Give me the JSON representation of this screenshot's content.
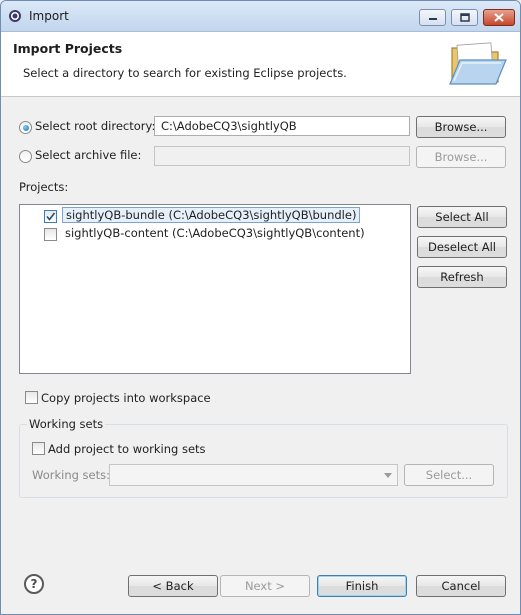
{
  "window": {
    "title": "Import",
    "icon": "eclipse-icon"
  },
  "banner": {
    "title": "Import Projects",
    "description": "Select a directory to search for existing Eclipse projects.",
    "icon": "open-folder-icon"
  },
  "source": {
    "root_label": "Select root directory:",
    "root_value": "C:\\AdobeCQ3\\sightlyQB",
    "root_selected": true,
    "archive_label": "Select archive file:",
    "archive_value": "",
    "browse_label": "Browse..."
  },
  "projects": {
    "label": "Projects:",
    "items": [
      {
        "label": "sightlyQB-bundle (C:\\AdobeCQ3\\sightlyQB\\bundle)",
        "checked": true,
        "selected": true
      },
      {
        "label": "sightlyQB-content (C:\\AdobeCQ3\\sightlyQB\\content)",
        "checked": false,
        "selected": false
      }
    ],
    "select_all": "Select All",
    "deselect_all": "Deselect All",
    "refresh": "Refresh"
  },
  "options": {
    "copy_label": "Copy projects into workspace",
    "copy_checked": false
  },
  "working_sets": {
    "group_label": "Working sets",
    "add_label": "Add project to working sets",
    "add_checked": false,
    "sets_label": "Working sets:",
    "sets_value": "",
    "select_label": "Select..."
  },
  "footer": {
    "help": "?",
    "back": "< Back",
    "next": "Next >",
    "finish": "Finish",
    "cancel": "Cancel"
  },
  "colors": {
    "accent": "#3c7fb1",
    "selection": "#e6f0fa",
    "banner_bg": "#ffffff"
  }
}
